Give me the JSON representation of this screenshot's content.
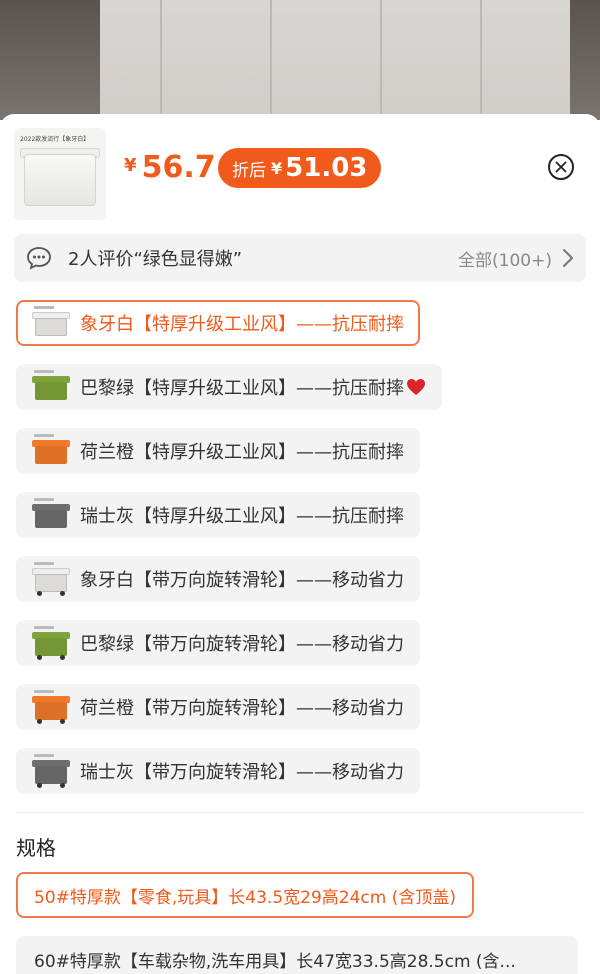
{
  "product": {
    "thumb_tag": "2022款发流行【象牙白】",
    "currency": "¥",
    "price": "56.7",
    "discount_label": "折后",
    "discount_price": "51.03"
  },
  "review": {
    "text": "2人评价“绿色显得嫩”",
    "all_label": "全部(100+)"
  },
  "options": [
    {
      "label": "象牙白【特厚升级工业风】——抗压耐摔",
      "color": "#efeeeb",
      "selected": true,
      "wheels": false,
      "heart": false
    },
    {
      "label": "巴黎绿【特厚升级工业风】——抗压耐摔",
      "color": "#7ea43a",
      "selected": false,
      "wheels": false,
      "heart": true
    },
    {
      "label": "荷兰橙【特厚升级工业风】——抗压耐摔",
      "color": "#f07a2a",
      "selected": false,
      "wheels": false,
      "heart": false
    },
    {
      "label": "瑞士灰【特厚升级工业风】——抗压耐摔",
      "color": "#6e6e6e",
      "selected": false,
      "wheels": false,
      "heart": false
    },
    {
      "label": "象牙白【带万向旋转滑轮】——移动省力",
      "color": "#efeeeb",
      "selected": false,
      "wheels": true,
      "heart": false
    },
    {
      "label": "巴黎绿【带万向旋转滑轮】——移动省力",
      "color": "#7ea43a",
      "selected": false,
      "wheels": true,
      "heart": false
    },
    {
      "label": "荷兰橙【带万向旋转滑轮】——移动省力",
      "color": "#f07a2a",
      "selected": false,
      "wheels": true,
      "heart": false
    },
    {
      "label": "瑞士灰【带万向旋转滑轮】——移动省力",
      "color": "#6e6e6e",
      "selected": false,
      "wheels": true,
      "heart": false
    }
  ],
  "spec_section": {
    "title": "规格",
    "items": [
      {
        "label": "50#特厚款【零食,玩具】长43.5宽29高24cm (含顶盖)",
        "selected": true
      },
      {
        "label": "60#特厚款【车载杂物,洗车用具】长47宽33.5高28.5cm (含...",
        "selected": false
      }
    ]
  },
  "colors": {
    "accent": "#f05a1a",
    "selected_border": "#f07a4a",
    "chip_bg": "#f3f3f3",
    "heart": "#d9252a"
  },
  "icons": {
    "close": "close-icon",
    "review": "chat-bubble-icon",
    "chevron": "chevron-right-icon",
    "heart": "heart-icon"
  }
}
